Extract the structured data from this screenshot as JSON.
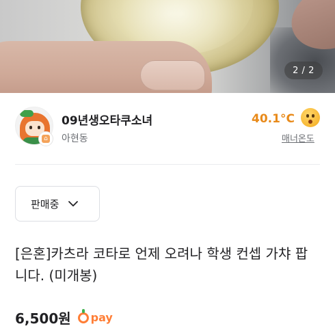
{
  "gallery": {
    "counter": "2 / 2"
  },
  "seller": {
    "nickname": "09년생오타쿠소녀",
    "region": "아현동",
    "temperature": "40.1°C",
    "manner_label": "매너온도",
    "temperature_color": "#e88a1a"
  },
  "status_dropdown": {
    "selected": "판매중"
  },
  "product": {
    "title": "[은혼]카츠라 코타로 언제 오려나 학생 컨셉 가챠 팝니다. (미개봉)",
    "price": "6,500원",
    "pay_label": "pay",
    "pay_color": "#ff7e36"
  },
  "icons": {
    "avatar": "avatar",
    "badge": "region-badge-icon",
    "emoji": "smile-face-icon",
    "chevron": "chevron-down-icon",
    "pay": "carrot-pay-icon"
  }
}
